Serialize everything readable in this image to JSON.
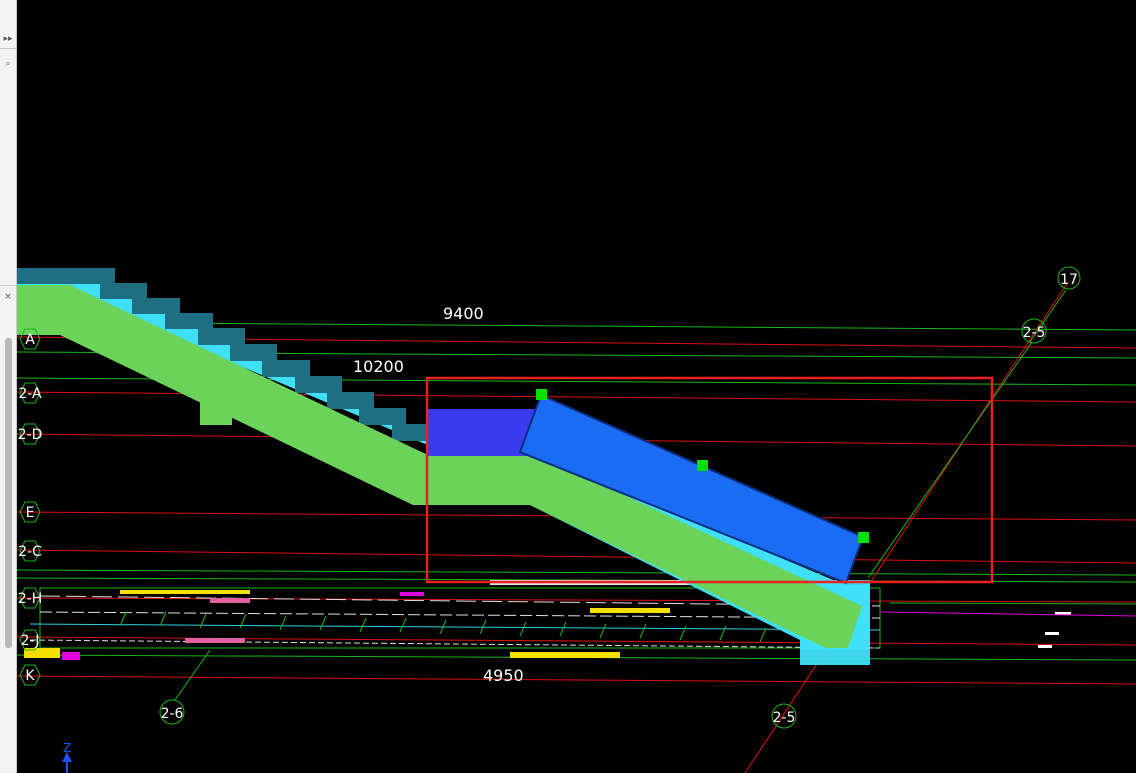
{
  "side_panel": {
    "buttons": [
      {
        "name": "expand-icon",
        "glyph": "▸▸"
      },
      {
        "name": "search-icon",
        "glyph": "⌕"
      },
      {
        "name": "close-icon",
        "glyph": "×"
      }
    ]
  },
  "dimensions": {
    "d_9400": "9400",
    "d_10200": "10200",
    "d_4950": "4950"
  },
  "grid_axes": {
    "left": [
      {
        "id": "A",
        "label": "A"
      },
      {
        "id": "2-A",
        "label": "2-A"
      },
      {
        "id": "2-D",
        "label": "2-D"
      },
      {
        "id": "E",
        "label": "E"
      },
      {
        "id": "2-C",
        "label": "2-C"
      },
      {
        "id": "2-H",
        "label": "2-H"
      },
      {
        "id": "2-J",
        "label": "2-J"
      },
      {
        "id": "K",
        "label": "K"
      }
    ],
    "top_right_17": "17",
    "top_right_2_5": "2-5",
    "bottom_2_6": "2-6",
    "bottom_2_5": "2-5"
  },
  "axis_indicator": {
    "z_label": "Z"
  },
  "colors": {
    "background": "#000000",
    "grid_red": "#e01010",
    "grid_green": "#18b818",
    "stair_green": "#6bd35a",
    "stair_cyan": "#3fe0f5",
    "stair_teal": "#1f6f82",
    "selected_blue": "#1a6cf5",
    "landing_purple": "#3a3af0",
    "grip_green": "#00e000",
    "selection_red": "#e82020"
  }
}
